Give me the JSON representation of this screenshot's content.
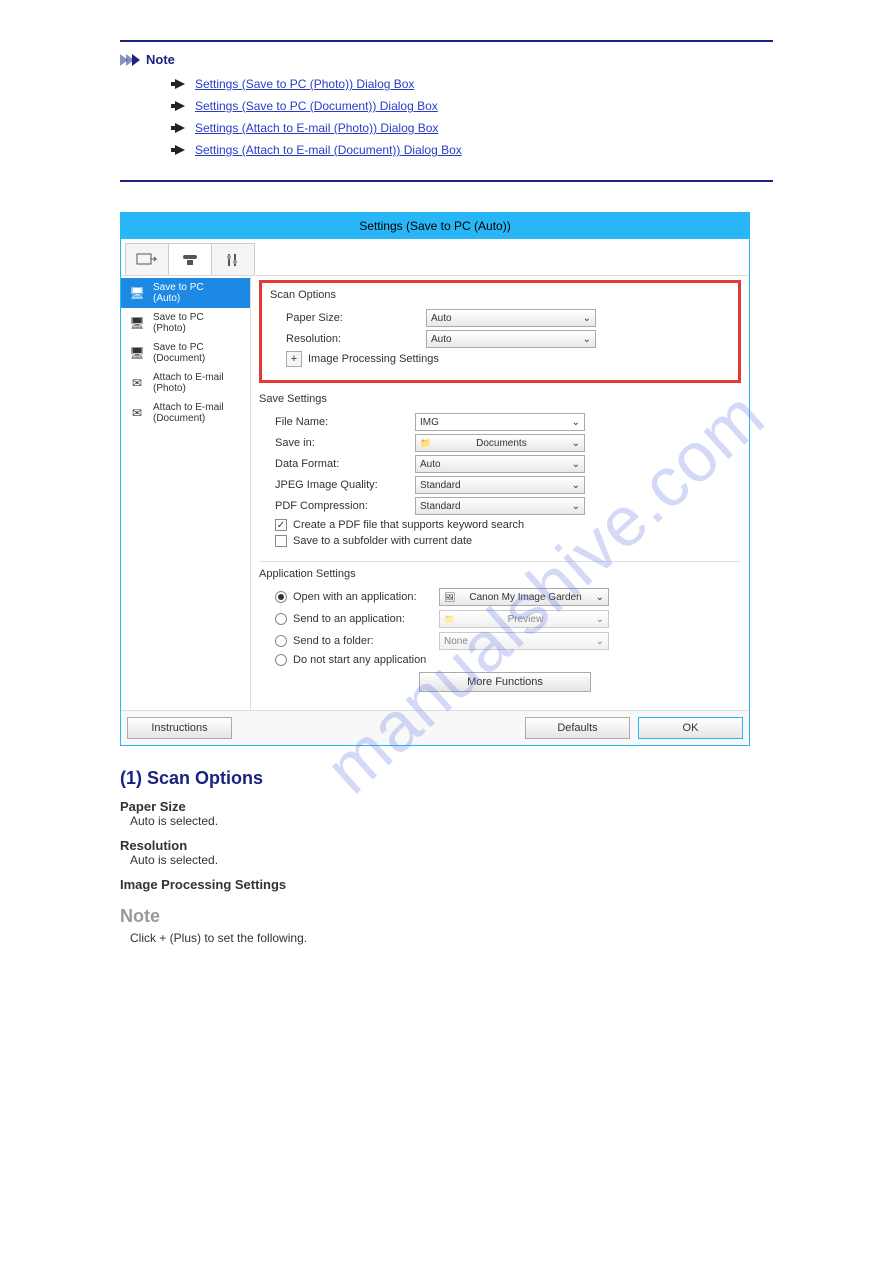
{
  "note": {
    "header": "Note",
    "items": [
      "Settings (Save to PC (Photo)) Dialog Box",
      "Settings (Save to PC (Document)) Dialog Box",
      "Settings (Attach to E-mail (Photo)) Dialog Box",
      "Settings (Attach to E-mail (Document)) Dialog Box"
    ]
  },
  "dialog": {
    "title": "Settings (Save to PC (Auto))",
    "sidebar": {
      "items": [
        {
          "l1": "Save to PC",
          "l2": "(Auto)"
        },
        {
          "l1": "Save to PC",
          "l2": "(Photo)"
        },
        {
          "l1": "Save to PC",
          "l2": "(Document)"
        },
        {
          "l1": "Attach to E-mail",
          "l2": "(Photo)"
        },
        {
          "l1": "Attach to E-mail",
          "l2": "(Document)"
        }
      ]
    },
    "scan": {
      "title": "Scan Options",
      "paper_label": "Paper Size:",
      "paper_value": "Auto",
      "res_label": "Resolution:",
      "res_value": "Auto",
      "imgproc": "Image Processing Settings"
    },
    "save": {
      "title": "Save Settings",
      "fn_label": "File Name:",
      "fn_value": "IMG",
      "si_label": "Save in:",
      "si_value": "Documents",
      "df_label": "Data Format:",
      "df_value": "Auto",
      "jq_label": "JPEG Image Quality:",
      "jq_value": "Standard",
      "pc_label": "PDF Compression:",
      "pc_value": "Standard",
      "cb1": "Create a PDF file that supports keyword search",
      "cb2": "Save to a subfolder with current date"
    },
    "app": {
      "title": "Application Settings",
      "r1": "Open with an application:",
      "r1v": "Canon My Image Garden",
      "r2": "Send to an application:",
      "r2v": "Preview",
      "r3": "Send to a folder:",
      "r3v": "None",
      "r4": "Do not start any application",
      "more": "More Functions"
    },
    "footer": {
      "instructions": "Instructions",
      "defaults": "Defaults",
      "ok": "OK"
    }
  },
  "below": {
    "a": "(1) Scan Options",
    "paper_name": "Paper Size",
    "paper_text": "Auto is selected.",
    "res_name": "Resolution",
    "res_text": "Auto is selected.",
    "img_name": "Image Processing Settings",
    "note_label": "Note",
    "note_text": "Click + (Plus) to set the following."
  },
  "watermark": "manualshive.com"
}
